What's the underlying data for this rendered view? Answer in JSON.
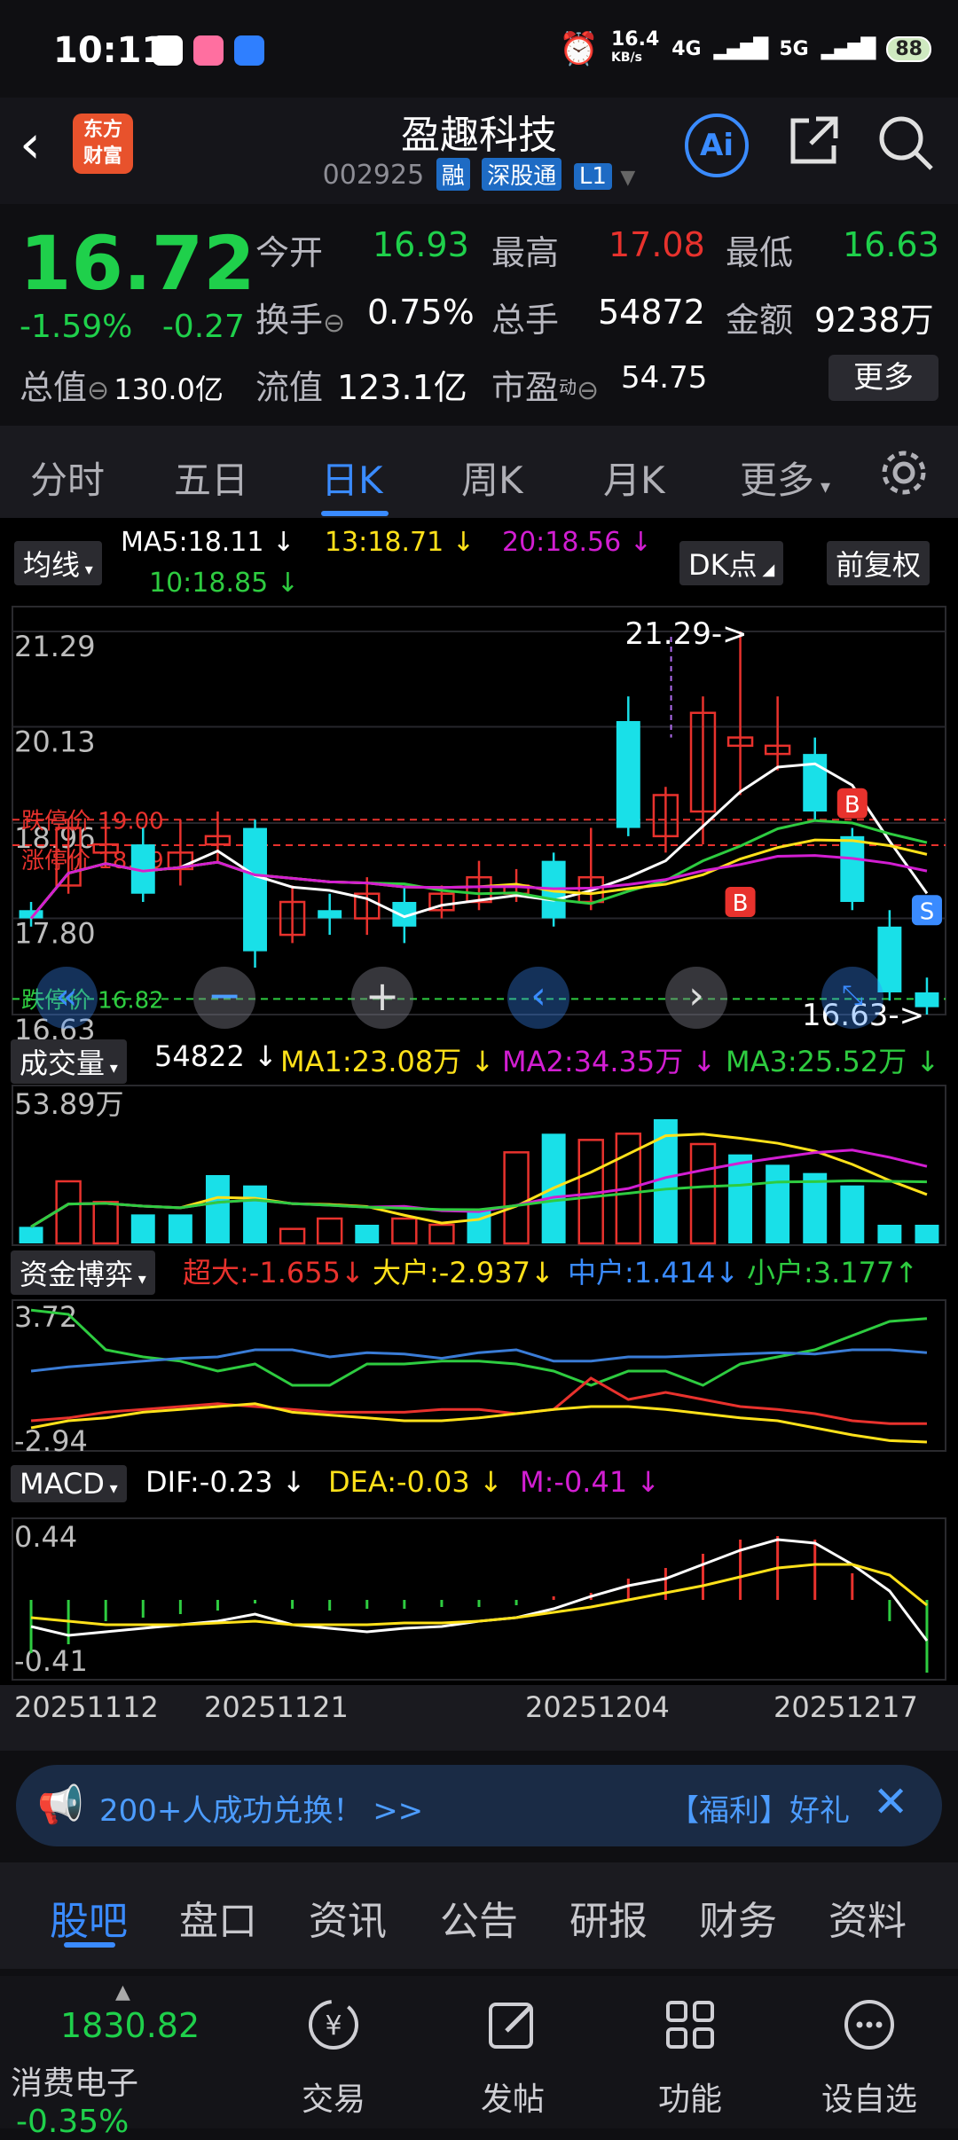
{
  "status_bar": {
    "time": "10:11",
    "net_speed": "16.4",
    "net_unit": "KB/s",
    "net_type": "4G",
    "net_type2": "5G",
    "battery": "88"
  },
  "header": {
    "logo_text_1": "东方",
    "logo_text_2": "财富",
    "title": "盈趣科技",
    "code": "002925",
    "tags": [
      "融",
      "深股通",
      "L1"
    ]
  },
  "quote": {
    "price": "16.72",
    "change_pct": "-1.59%",
    "change": "-0.27",
    "open_label": "今开",
    "open": "16.93",
    "high_label": "最高",
    "high": "17.08",
    "low_label": "最低",
    "low": "16.63",
    "turnover_label": "换手",
    "turnover": "0.75%",
    "volume_label": "总手",
    "volume": "54872",
    "amount_label": "金额",
    "amount": "9238万",
    "mktcap_label": "总值",
    "mktcap": "130.0亿",
    "float_label": "流值",
    "float_cap": "123.1亿",
    "pe_label": "市盈",
    "pe_sup": "动",
    "pe": "54.75",
    "more": "更多"
  },
  "tabs": [
    {
      "label": "分时"
    },
    {
      "label": "五日"
    },
    {
      "label": "日K"
    },
    {
      "label": "周K"
    },
    {
      "label": "月K"
    },
    {
      "label": "更多"
    }
  ],
  "kline": {
    "ma_chip": "均线",
    "ma5": "MA5:18.11",
    "ma13": "13:18.71",
    "ma20": "20:18.56",
    "ma10": "10:18.85",
    "dk_chip": "DK点",
    "adj_chip": "前复权",
    "y_labels": [
      "21.29",
      "20.13",
      "18.96",
      "17.80",
      "16.63"
    ],
    "high_mark": "21.29->",
    "low_mark": "16.63->",
    "limit_up_a": "跌停价 19.00",
    "limit_up_b": "涨停价 18.69",
    "limit_down": "跌停价 16.82",
    "signals": [
      "B",
      "B",
      "S"
    ]
  },
  "volume_panel": {
    "chip": "成交量",
    "value": "54822",
    "ma1": "MA1:23.08万",
    "ma2": "MA2:34.35万",
    "ma3": "MA3:25.52万",
    "y_top": "53.89万"
  },
  "fund_panel": {
    "chip": "资金博弈",
    "super": "超大:-1.655",
    "large": "大户:-2.937",
    "medium": "中户:1.414",
    "small": "小户:3.177",
    "y_top": "3.72",
    "y_bottom": "-2.94"
  },
  "macd_panel": {
    "chip": "MACD",
    "dif": "DIF:-0.23",
    "dea": "DEA:-0.03",
    "m": "M:-0.41",
    "y_top": "0.44",
    "y_bottom": "-0.41"
  },
  "dates": [
    "20251112",
    "20251121",
    "20251204",
    "20251217"
  ],
  "banner": {
    "text": "200+人成功兑换！ >>",
    "right": "【福利】好礼"
  },
  "subtabs": [
    {
      "label": "股吧"
    },
    {
      "label": "盘口"
    },
    {
      "label": "资讯"
    },
    {
      "label": "公告"
    },
    {
      "label": "研报"
    },
    {
      "label": "财务"
    },
    {
      "label": "资料"
    }
  ],
  "nav": {
    "index_value": "1830.82",
    "index_name": "消费电子",
    "index_change": "-0.35%",
    "items": [
      {
        "label": "交易"
      },
      {
        "label": "发帖"
      },
      {
        "label": "功能"
      },
      {
        "label": "设自选"
      }
    ]
  },
  "colors": {
    "up": "#e8322d",
    "down": "#19e0e8",
    "green": "#1fd04b",
    "accent": "#3a8bff",
    "ma5": "#ffffff",
    "ma10": "#2ecc40",
    "ma13": "#ffe11a",
    "ma20": "#d21ed2"
  },
  "chart_data": {
    "type": "candlestick",
    "dates": [
      "20251112",
      "20251121",
      "20251204",
      "20251217"
    ],
    "ylim": [
      16.63,
      21.29
    ],
    "candles": [
      {
        "o": 17.9,
        "c": 17.8,
        "h": 18.0,
        "l": 17.7,
        "up": false
      },
      {
        "o": 18.2,
        "c": 18.9,
        "h": 19.0,
        "l": 18.1,
        "up": true
      },
      {
        "o": 18.6,
        "c": 18.7,
        "h": 19.1,
        "l": 18.5,
        "up": true
      },
      {
        "o": 18.7,
        "c": 18.1,
        "h": 18.9,
        "l": 18.0,
        "up": false
      },
      {
        "o": 18.4,
        "c": 18.6,
        "h": 19.0,
        "l": 18.2,
        "up": true
      },
      {
        "o": 18.7,
        "c": 18.8,
        "h": 19.1,
        "l": 18.5,
        "up": true
      },
      {
        "o": 18.9,
        "c": 17.4,
        "h": 19.0,
        "l": 17.2,
        "up": false
      },
      {
        "o": 17.6,
        "c": 18.0,
        "h": 18.2,
        "l": 17.5,
        "up": true
      },
      {
        "o": 17.8,
        "c": 17.9,
        "h": 18.1,
        "l": 17.6,
        "up": false
      },
      {
        "o": 17.8,
        "c": 18.1,
        "h": 18.3,
        "l": 17.6,
        "up": true
      },
      {
        "o": 18.0,
        "c": 17.7,
        "h": 18.2,
        "l": 17.5,
        "up": false
      },
      {
        "o": 17.9,
        "c": 18.1,
        "h": 18.2,
        "l": 17.8,
        "up": true
      },
      {
        "o": 18.0,
        "c": 18.3,
        "h": 18.5,
        "l": 17.9,
        "up": true
      },
      {
        "o": 18.1,
        "c": 18.2,
        "h": 18.4,
        "l": 18.0,
        "up": true
      },
      {
        "o": 18.5,
        "c": 17.8,
        "h": 18.6,
        "l": 17.7,
        "up": false
      },
      {
        "o": 18.0,
        "c": 18.3,
        "h": 18.9,
        "l": 17.9,
        "up": true
      },
      {
        "o": 20.2,
        "c": 18.9,
        "h": 20.5,
        "l": 18.8,
        "up": false
      },
      {
        "o": 18.8,
        "c": 19.3,
        "h": 19.4,
        "l": 18.6,
        "up": true
      },
      {
        "o": 19.1,
        "c": 20.3,
        "h": 20.5,
        "l": 18.7,
        "up": true
      },
      {
        "o": 20.0,
        "c": 19.9,
        "h": 21.29,
        "l": 19.3,
        "up": true
      },
      {
        "o": 19.9,
        "c": 19.8,
        "h": 20.5,
        "l": 19.6,
        "up": true
      },
      {
        "o": 19.8,
        "c": 19.1,
        "h": 20.0,
        "l": 19.0,
        "up": false
      },
      {
        "o": 18.8,
        "c": 18.0,
        "h": 18.9,
        "l": 17.9,
        "up": false
      },
      {
        "o": 17.7,
        "c": 16.9,
        "h": 17.9,
        "l": 16.8,
        "up": false
      },
      {
        "o": 16.9,
        "c": 16.72,
        "h": 17.08,
        "l": 16.63,
        "up": false
      }
    ],
    "volume": [
      8,
      30,
      20,
      14,
      14,
      33,
      28,
      7,
      12,
      9,
      12,
      9,
      16,
      44,
      53,
      50,
      53,
      60,
      48,
      43,
      38,
      34,
      28,
      9,
      9
    ],
    "volume_up": [
      false,
      true,
      true,
      false,
      false,
      false,
      false,
      true,
      true,
      false,
      true,
      true,
      false,
      true,
      false,
      true,
      true,
      false,
      true,
      false,
      false,
      false,
      false,
      false,
      false
    ]
  }
}
